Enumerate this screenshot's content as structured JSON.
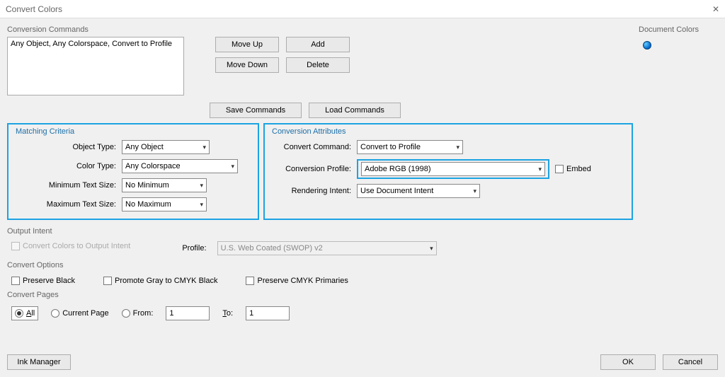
{
  "title": "Convert Colors",
  "conversion_commands": {
    "label": "Conversion Commands",
    "entry": "Any Object, Any Colorspace, Convert to Profile",
    "move_up": "Move Up",
    "move_down": "Move Down",
    "add": "Add",
    "delete": "Delete",
    "save": "Save Commands",
    "load": "Load Commands"
  },
  "matching": {
    "label": "Matching Criteria",
    "object_type_lbl": "Object Type:",
    "object_type": "Any Object",
    "color_type_lbl": "Color Type:",
    "color_type": "Any Colorspace",
    "min_lbl": "Minimum Text Size:",
    "min": "No Minimum",
    "max_lbl": "Maximum Text Size:",
    "max": "No Maximum"
  },
  "attributes": {
    "label": "Conversion Attributes",
    "convert_cmd_lbl": "Convert Command:",
    "convert_cmd": "Convert to Profile",
    "profile_lbl": "Conversion Profile:",
    "profile": "Adobe RGB (1998)",
    "embed": "Embed",
    "intent_lbl": "Rendering Intent:",
    "intent": "Use Document Intent"
  },
  "output_intent": {
    "label": "Output Intent",
    "convert_chk": "Convert Colors to Output Intent",
    "profile_lbl": "Profile:",
    "profile": "U.S. Web Coated (SWOP) v2"
  },
  "options": {
    "label": "Convert Options",
    "preserve_black": "Preserve Black",
    "promote_gray": "Promote Gray to CMYK Black",
    "preserve_cmyk": "Preserve CMYK Primaries"
  },
  "pages": {
    "label": "Convert Pages",
    "all": "All",
    "current": "Current Page",
    "from": "From:",
    "from_val": "1",
    "to": "To:",
    "to_val": "1"
  },
  "doc_colors": {
    "label": "Document Colors"
  },
  "footer": {
    "ink_mgr": "Ink Manager",
    "ok": "OK",
    "cancel": "Cancel"
  }
}
